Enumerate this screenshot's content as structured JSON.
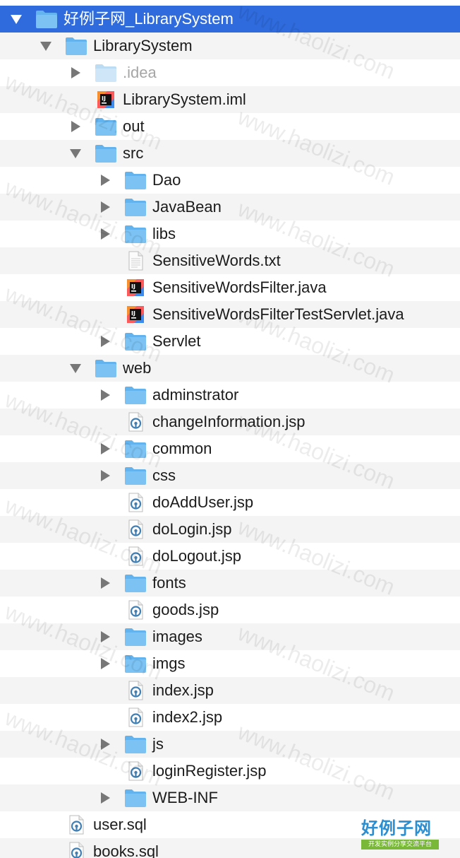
{
  "tree": {
    "rows": [
      {
        "label": "好例子网_LibrarySystem",
        "icon": "folder",
        "depth": 0,
        "arrow": "down",
        "selected": true
      },
      {
        "label": "LibrarySystem",
        "icon": "folder",
        "depth": 1,
        "arrow": "down"
      },
      {
        "label": ".idea",
        "icon": "folder",
        "depth": 2,
        "arrow": "right",
        "dim": true
      },
      {
        "label": "LibrarySystem.iml",
        "icon": "intellij",
        "depth": 2,
        "arrow": "none"
      },
      {
        "label": "out",
        "icon": "folder",
        "depth": 2,
        "arrow": "right"
      },
      {
        "label": "src",
        "icon": "folder",
        "depth": 2,
        "arrow": "down"
      },
      {
        "label": "Dao",
        "icon": "folder",
        "depth": 3,
        "arrow": "right"
      },
      {
        "label": "JavaBean",
        "icon": "folder",
        "depth": 3,
        "arrow": "right"
      },
      {
        "label": "libs",
        "icon": "folder",
        "depth": 3,
        "arrow": "right"
      },
      {
        "label": "SensitiveWords.txt",
        "icon": "text",
        "depth": 3,
        "arrow": "none"
      },
      {
        "label": "SensitiveWordsFilter.java",
        "icon": "intellij",
        "depth": 3,
        "arrow": "none"
      },
      {
        "label": "SensitiveWordsFilterTestServlet.java",
        "icon": "intellij",
        "depth": 3,
        "arrow": "none"
      },
      {
        "label": "Servlet",
        "icon": "folder",
        "depth": 3,
        "arrow": "right"
      },
      {
        "label": "web",
        "icon": "folder",
        "depth": 2,
        "arrow": "down"
      },
      {
        "label": "adminstrator",
        "icon": "folder",
        "depth": 3,
        "arrow": "right"
      },
      {
        "label": "changeInformation.jsp",
        "icon": "script",
        "depth": 3,
        "arrow": "none"
      },
      {
        "label": "common",
        "icon": "folder",
        "depth": 3,
        "arrow": "right"
      },
      {
        "label": "css",
        "icon": "folder",
        "depth": 3,
        "arrow": "right"
      },
      {
        "label": "doAddUser.jsp",
        "icon": "script",
        "depth": 3,
        "arrow": "none"
      },
      {
        "label": "doLogin.jsp",
        "icon": "script",
        "depth": 3,
        "arrow": "none"
      },
      {
        "label": "doLogout.jsp",
        "icon": "script",
        "depth": 3,
        "arrow": "none"
      },
      {
        "label": "fonts",
        "icon": "folder",
        "depth": 3,
        "arrow": "right"
      },
      {
        "label": "goods.jsp",
        "icon": "script",
        "depth": 3,
        "arrow": "none"
      },
      {
        "label": "images",
        "icon": "folder",
        "depth": 3,
        "arrow": "right"
      },
      {
        "label": "imgs",
        "icon": "folder",
        "depth": 3,
        "arrow": "right"
      },
      {
        "label": "index.jsp",
        "icon": "script",
        "depth": 3,
        "arrow": "none"
      },
      {
        "label": "index2.jsp",
        "icon": "script",
        "depth": 3,
        "arrow": "none"
      },
      {
        "label": "js",
        "icon": "folder",
        "depth": 3,
        "arrow": "right"
      },
      {
        "label": "loginRegister.jsp",
        "icon": "script",
        "depth": 3,
        "arrow": "none"
      },
      {
        "label": "WEB-INF",
        "icon": "folder",
        "depth": 3,
        "arrow": "right"
      },
      {
        "label": "user.sql",
        "icon": "script",
        "depth": 1,
        "arrow": "none"
      },
      {
        "label": "books.sql",
        "icon": "script",
        "depth": 1,
        "arrow": "none"
      }
    ]
  },
  "watermark": {
    "text": "www.haolizi.com"
  },
  "logo": {
    "brand": "好例子网",
    "slogan": "开发实例分享交流平台"
  },
  "colors": {
    "selection": "#2f6bdd",
    "folder": "#7cc3f4",
    "stripe": "#f4f4f4"
  }
}
